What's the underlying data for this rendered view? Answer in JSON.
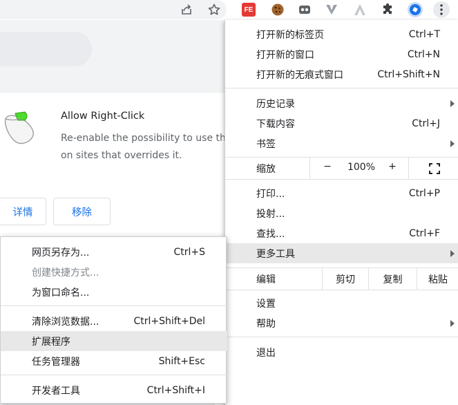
{
  "colors": {
    "accent": "#1a73e8",
    "highlight": "#e8e8e8",
    "ext_fe": "#e53935",
    "ext_active": "#1a73e8"
  },
  "toolbar": {
    "icons": [
      "share-icon",
      "star-icon",
      "fe-extension-icon",
      "cookie-extension-icon",
      "cat-extension-icon",
      "v-extension-icon",
      "a-extension-icon",
      "puzzle-icon",
      "active-extension-icon",
      "kebab-menu-icon"
    ],
    "ext_fe_label": "FE"
  },
  "card": {
    "title": "Allow Right-Click",
    "desc_line1": "Re-enable the possibility to use the",
    "desc_line2": "on sites that overrides it.",
    "details_label": "详情",
    "remove_label": "移除"
  },
  "main_menu": {
    "new_tab": {
      "label": "打开新的标签页",
      "shortcut": "Ctrl+T"
    },
    "new_window": {
      "label": "打开新的窗口",
      "shortcut": "Ctrl+N"
    },
    "new_incognito": {
      "label": "打开新的无痕式窗口",
      "shortcut": "Ctrl+Shift+N"
    },
    "history": {
      "label": "历史记录"
    },
    "downloads": {
      "label": "下载内容",
      "shortcut": "Ctrl+J"
    },
    "bookmarks": {
      "label": "书签"
    },
    "zoom": {
      "label": "缩放",
      "minus": "−",
      "value": "100%",
      "plus": "+"
    },
    "print": {
      "label": "打印...",
      "shortcut": "Ctrl+P"
    },
    "cast": {
      "label": "投射..."
    },
    "find": {
      "label": "查找...",
      "shortcut": "Ctrl+F"
    },
    "more_tools": {
      "label": "更多工具"
    },
    "edit": {
      "label": "编辑",
      "cut": "剪切",
      "copy": "复制",
      "paste": "粘贴"
    },
    "settings": {
      "label": "设置"
    },
    "help": {
      "label": "帮助"
    },
    "exit": {
      "label": "退出"
    }
  },
  "sub_menu": {
    "save_page": {
      "label": "网页另存为...",
      "shortcut": "Ctrl+S"
    },
    "create_shortcut": {
      "label": "创建快捷方式..."
    },
    "name_window": {
      "label": "为窗口命名..."
    },
    "clear_data": {
      "label": "清除浏览数据...",
      "shortcut": "Ctrl+Shift+Del"
    },
    "extensions": {
      "label": "扩展程序"
    },
    "task_manager": {
      "label": "任务管理器",
      "shortcut": "Shift+Esc"
    },
    "dev_tools": {
      "label": "开发者工具",
      "shortcut": "Ctrl+Shift+I"
    }
  }
}
